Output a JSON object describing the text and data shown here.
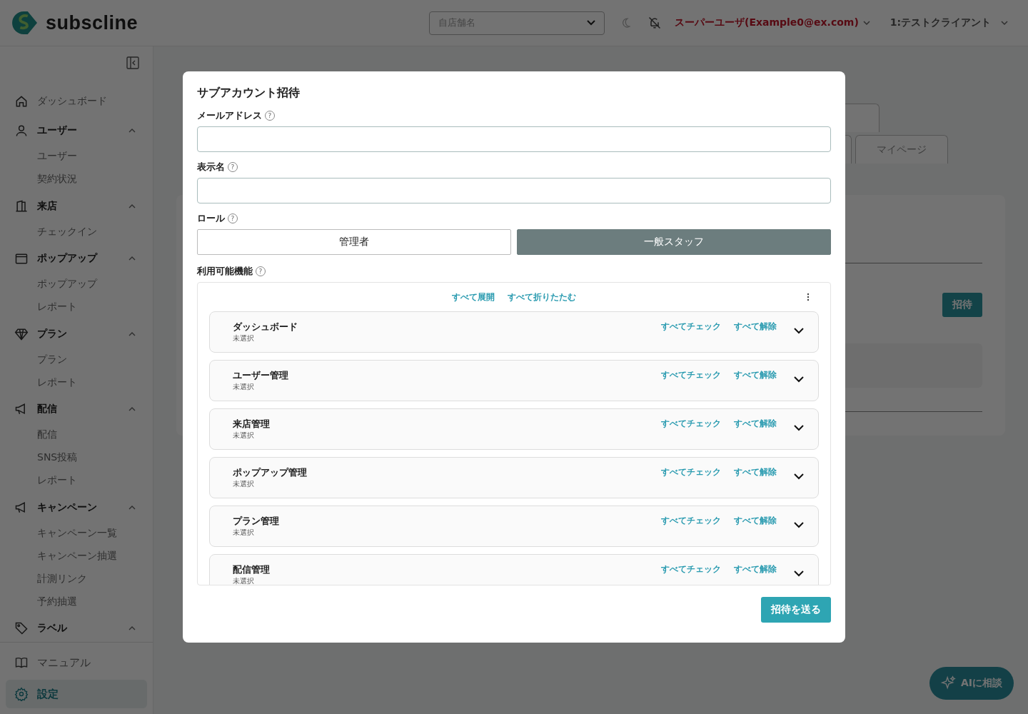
{
  "header": {
    "brand": "subscline",
    "store_select": {
      "placeholder": "自店舗名"
    },
    "user": "スーパーユーザ(Example0@ex.com)",
    "client": "1:テストクライアント"
  },
  "sidebar": {
    "items": [
      {
        "label": "ダッシュボード"
      },
      {
        "label": "ユーザー",
        "expanded": true,
        "children": [
          {
            "label": "ユーザー",
            "selected": false
          },
          {
            "label": "契約状況",
            "selected": false
          }
        ]
      },
      {
        "label": "来店",
        "expanded": true,
        "children": [
          {
            "label": "チェックイン",
            "selected": false
          }
        ]
      },
      {
        "label": "ポップアップ",
        "expanded": true,
        "children": [
          {
            "label": "ポップアップ",
            "selected": false
          },
          {
            "label": "レポート",
            "selected": false
          }
        ]
      },
      {
        "label": "プラン",
        "expanded": true,
        "children": [
          {
            "label": "プラン",
            "selected": false
          },
          {
            "label": "レポート",
            "selected": false
          }
        ]
      },
      {
        "label": "配信",
        "expanded": true,
        "children": [
          {
            "label": "配信",
            "selected": false
          },
          {
            "label": "SNS投稿",
            "selected": false
          },
          {
            "label": "レポート",
            "selected": false
          }
        ]
      },
      {
        "label": "キャンペーン",
        "expanded": true,
        "children": [
          {
            "label": "キャンペーン一覧",
            "selected": false
          },
          {
            "label": "キャンペーン抽選",
            "selected": false
          },
          {
            "label": "計測リンク",
            "selected": false
          },
          {
            "label": "予約抽選",
            "selected": false
          }
        ]
      },
      {
        "label": "ラベル",
        "expanded": true
      }
    ],
    "footer": [
      {
        "label": "マニュアル",
        "selected": false
      },
      {
        "label": "設定",
        "selected": true
      }
    ]
  },
  "page": {
    "tabs": [
      {
        "label": "マイページ"
      }
    ],
    "invite_button": "招待"
  },
  "dialog": {
    "title": "サブアカウント招待",
    "fields": [
      {
        "label": "メールアドレス",
        "help": "?"
      },
      {
        "label": "表示名",
        "help": "?"
      }
    ],
    "role": {
      "label": "ロール",
      "help": "?",
      "options": [
        {
          "label": "管理者",
          "selected": false
        },
        {
          "label": "一般スタッフ",
          "selected": true
        }
      ]
    },
    "features": {
      "label": "利用可能機能",
      "help": "?",
      "expand_all": "すべて展開",
      "collapse_all": "すべて折りたたむ",
      "groups": [
        {
          "name": "ダッシュボード",
          "status": "未選択",
          "check_all": "すべてチェック",
          "clear_all": "すべて解除",
          "expanded": false
        },
        {
          "name": "ユーザー管理",
          "status": "未選択",
          "check_all": "すべてチェック",
          "clear_all": "すべて解除",
          "expanded": false
        },
        {
          "name": "来店管理",
          "status": "未選択",
          "check_all": "すべてチェック",
          "clear_all": "すべて解除",
          "expanded": false
        },
        {
          "name": "ポップアップ管理",
          "status": "未選択",
          "check_all": "すべてチェック",
          "clear_all": "すべて解除",
          "expanded": false
        },
        {
          "name": "プラン管理",
          "status": "未選択",
          "check_all": "すべてチェック",
          "clear_all": "すべて解除",
          "expanded": false
        },
        {
          "name": "配信管理",
          "status": "未選択",
          "check_all": "すべてチェック",
          "clear_all": "すべて解除",
          "expanded": false
        }
      ]
    },
    "submit": "招待を送る"
  },
  "ai_button": "AIに相談"
}
